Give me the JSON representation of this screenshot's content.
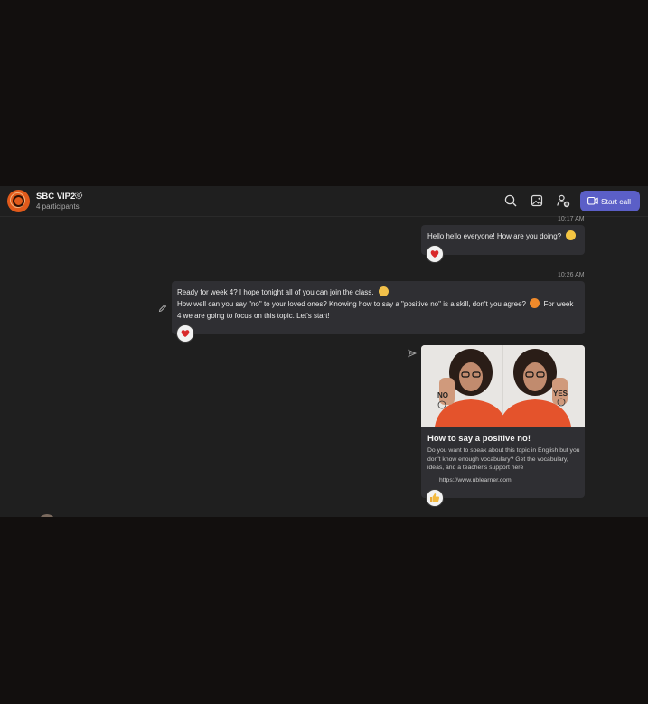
{
  "chat": {
    "title": "SBC VIP2",
    "participants": "4 participants",
    "start_call_label": "Start call"
  },
  "header_icons": [
    "search-icon",
    "gallery-icon",
    "add-people-icon",
    "video-camera-icon"
  ],
  "messages": [
    {
      "time": "10:17 AM",
      "text": "Hello hello everyone! How are you doing?",
      "reaction": "heart"
    },
    {
      "time": "10:26 AM",
      "line1": "Ready for week 4? I hope tonight all of you can join the class.",
      "line2": "How well can you say \"no\" to your loved ones? Knowing how to say a \"positive no\" is a skill, don't you agree?",
      "line2b": "For week",
      "line3": "4 we are going to focus on this topic. Let's start!",
      "reaction": "heart"
    }
  ],
  "link_card": {
    "image_text_left": "NO",
    "image_text_right": "YES",
    "title": "How to say a positive no!",
    "description": "Do you want to speak about this topic in English but you don't know enough vocabulary? Get the vocabulary, ideas, and a teacher's support here",
    "url": "https://www.ublearner.com",
    "reaction": "thumbs-up"
  },
  "colors": {
    "background": "#1f1f1f",
    "outside": "#120f0e",
    "bubble": "#2f2f33",
    "accent": "#5b5fc7",
    "avatar": "#e05a1b",
    "heart": "#d9292b"
  }
}
